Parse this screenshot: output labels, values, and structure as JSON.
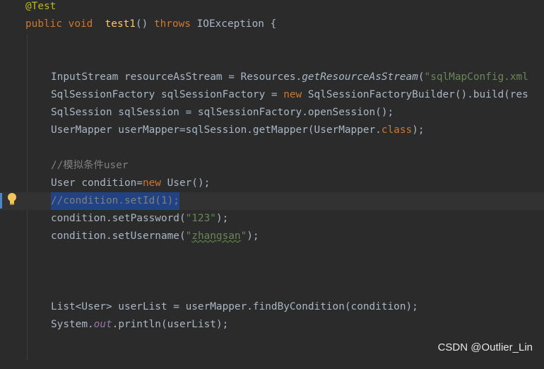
{
  "editor": {
    "lines": {
      "annotation": "@Test",
      "sig_public": "public",
      "sig_void": "void",
      "sig_method": "test1",
      "sig_parens": "()",
      "sig_throws": "throws",
      "sig_exception": "IOException {",
      "l1_a": "InputStream resourceAsStream = Resources.",
      "l1_method": "getResourceAsStream",
      "l1_paren": "(",
      "l1_str": "\"sqlMapConfig.xml",
      "l2_a": "SqlSessionFactory sqlSessionFactory = ",
      "l2_new": "new",
      "l2_b": " SqlSessionFactoryBuilder().build(res",
      "l3": "SqlSession sqlSession = sqlSessionFactory.openSession();",
      "l4_a": "UserMapper userMapper=sqlSession.getMapper(UserMapper.",
      "l4_class": "class",
      "l4_b": ");",
      "comment_cond": "//模拟条件user",
      "l5_a": "User condition=",
      "l5_new": "new",
      "l5_b": " User();",
      "l6_selected": "//condition.setId(1);",
      "l7_a": "condition.setPassword(",
      "l7_str": "\"123\"",
      "l7_b": ");",
      "l8_a": "condition.setUsername(",
      "l8_q1": "\"",
      "l8_str": "zhangsan",
      "l8_q2": "\"",
      "l8_b": ");",
      "l9": "List<User> userList = userMapper.findByCondition(condition);",
      "l10_a": "System.",
      "l10_field": "out",
      "l10_b": ".println(userList);"
    }
  },
  "icons": {
    "intention_bulb": "lightbulb-icon"
  },
  "watermark": "CSDN @Outlier_Lin",
  "colors": {
    "background": "#2b2b2b",
    "keyword": "#cc7832",
    "string": "#6a8759",
    "comment": "#808080",
    "selection": "#214283",
    "method_decl": "#ffc66d"
  }
}
